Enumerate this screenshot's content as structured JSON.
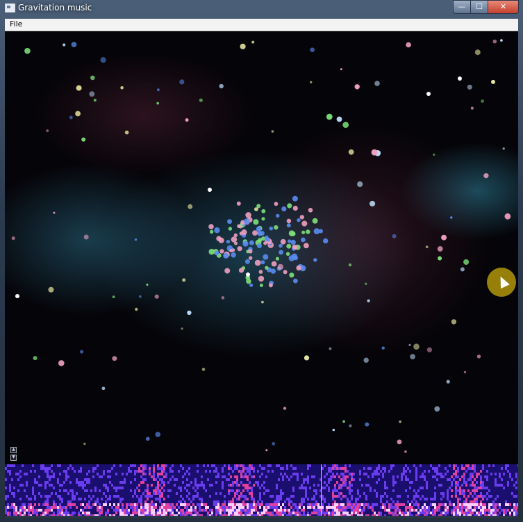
{
  "window": {
    "title": "Gravitation music",
    "minimize_label": "—",
    "maximize_label": "☐",
    "close_label": "✕"
  },
  "menu": {
    "items": [
      "File"
    ]
  },
  "scene": {
    "background_color": "#050408",
    "nebula_colors": [
      "#1b4a63",
      "#3a1e2e",
      "#2a5c72"
    ],
    "particle_colors": [
      "#5a8cf0",
      "#7de07a",
      "#f0a0c0",
      "#c0e0ff",
      "#e8e8a0"
    ]
  },
  "spectrogram": {
    "colors": [
      "#1a0f6e",
      "#6a3cf0",
      "#e040a0",
      "#ffd0ff"
    ]
  },
  "icons": {
    "mini_up": "▲",
    "mini_down": "▼",
    "cursor": "cursor-icon"
  }
}
